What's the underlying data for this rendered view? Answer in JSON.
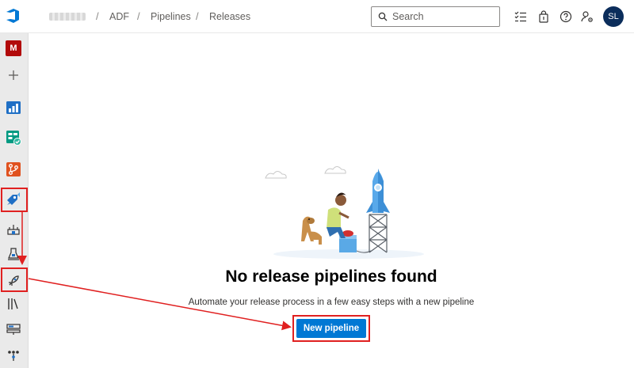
{
  "header": {
    "breadcrumbs": [
      "ADF",
      "Pipelines",
      "Releases"
    ],
    "separator": "/",
    "search_placeholder": "Search",
    "user_initials": "SL",
    "icons": [
      "azure-devops-logo-icon",
      "checklist-icon",
      "shopping-bag-icon",
      "help-icon",
      "user-settings-icon"
    ]
  },
  "sidebar": {
    "org_initial": "M",
    "items": [
      "add-icon",
      "overview-icon",
      "boards-icon",
      "repos-icon",
      "pipelines-icon",
      "environments-icon",
      "builds-icon",
      "releases-icon",
      "library-icon",
      "task-groups-icon",
      "deployment-groups-icon"
    ]
  },
  "main": {
    "heading": "No release pipelines found",
    "subtext": "Automate your release process in a few easy steps with a new pipeline",
    "new_pipeline_label": "New pipeline"
  },
  "colors": {
    "accent": "#0078d4",
    "annotation": "#e02020",
    "org_tile": "#b20a0a",
    "avatar": "#0b2d5b"
  }
}
